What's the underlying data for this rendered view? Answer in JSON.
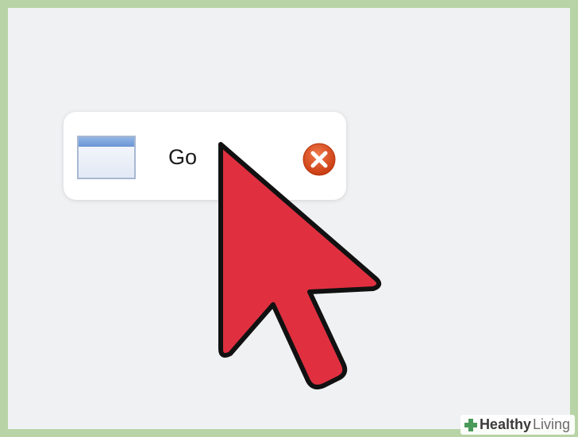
{
  "taskbar_item": {
    "label": "Go",
    "icon": "window-icon",
    "close_icon": "close-icon"
  },
  "cursor": {
    "icon": "mouse-pointer-icon",
    "color": "#e03040"
  },
  "watermark": {
    "bold": "Healthy",
    "light": "Living",
    "icon": "plus-icon"
  },
  "colors": {
    "border": "#b8d4a6",
    "background": "#f0f1f3",
    "close_button": "#e04a1a"
  }
}
